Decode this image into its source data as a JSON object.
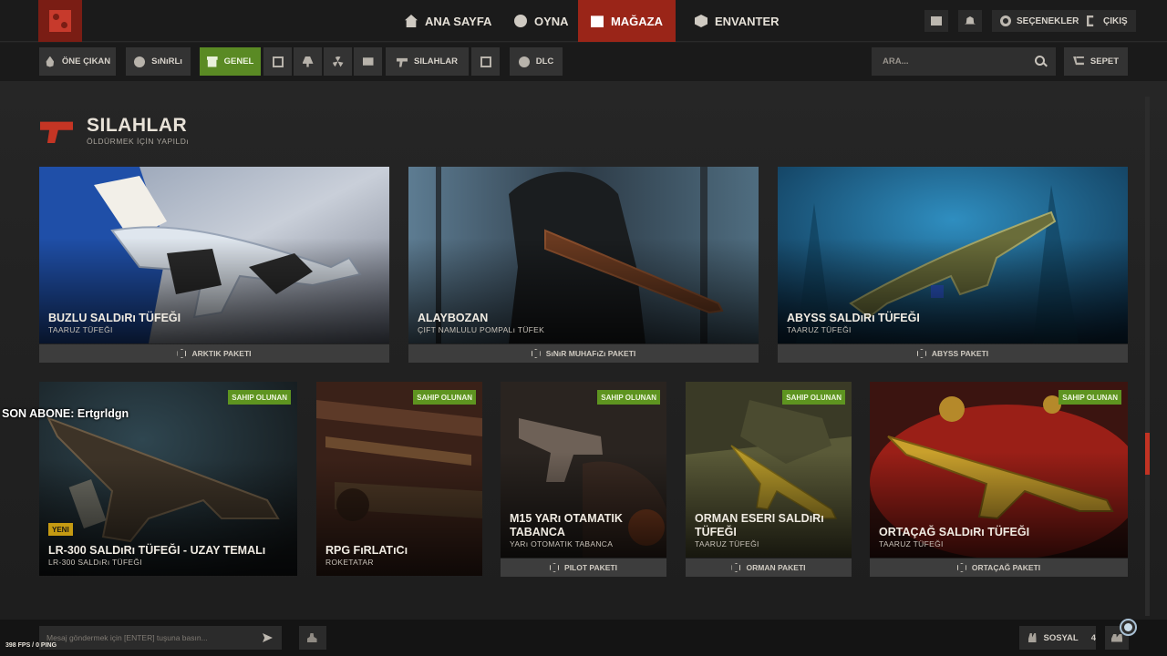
{
  "topnav": {
    "items": [
      {
        "label": "ANA SAYFA",
        "icon": "home-icon"
      },
      {
        "label": "OYNA",
        "icon": "play-icon"
      },
      {
        "label": "MAĞAZA",
        "icon": "store-icon",
        "active": true
      },
      {
        "label": "ENVANTER",
        "icon": "inventory-icon"
      }
    ],
    "options_label": "SEÇENEKLER",
    "exit_label": "ÇIKIŞ"
  },
  "subnav": {
    "featured_label": "ÖNE ÇIKAN",
    "limited_label": "SıNıRLı",
    "general_label": "GENEL",
    "weapons_label": "SILAHLAR",
    "dlc_label": "DLC",
    "search_placeholder": "ARA...",
    "cart_label": "SEPET"
  },
  "section": {
    "title": "SILAHLAR",
    "subtitle": "ÖLDÜRMEK İÇİN YAPILDı"
  },
  "large_cards": [
    {
      "title": "BUZLU SALDıRı TÜFEĞI",
      "subtitle": "TAARUZ TÜFEĞI",
      "package": "ARKTIK PAKETI"
    },
    {
      "title": "ALAYBOZAN",
      "subtitle": "ÇIFT NAMLULU POMPALı TÜFEK",
      "package": "SıNıR MUHAFıZı PAKETI"
    },
    {
      "title": "ABYSS SALDıRı TÜFEĞI",
      "subtitle": "TAARUZ TÜFEĞI",
      "package": "ABYSS PAKETI"
    }
  ],
  "small_cards": [
    {
      "title": "LR-300 SALDıRı TÜFEĞI - UZAY TEMALı",
      "subtitle": "LR-300 SALDıRı TÜFEĞI",
      "badge": "SAHIP OLUNAN",
      "tag": "YENI"
    },
    {
      "title": "RPG FıRLATıCı",
      "subtitle": "ROKETATAR",
      "badge": "SAHIP OLUNAN"
    },
    {
      "title_line1": "M15 YARı OTAMATIK",
      "title_line2": "TABANCA",
      "subtitle": "YARı OTOMATIK TABANCA",
      "badge": "SAHIP OLUNAN",
      "package": "PILOT PAKETI"
    },
    {
      "title_line1": "ORMAN ESERI SALDıRı",
      "title_line2": "TÜFEĞI",
      "subtitle": "TAARUZ TÜFEĞI",
      "badge": "SAHIP OLUNAN",
      "package": "ORMAN PAKETI"
    },
    {
      "title": "ORTAÇAĞ SALDıRı TÜFEĞI",
      "subtitle": "TAARUZ TÜFEĞI",
      "badge": "SAHIP OLUNAN",
      "package": "ORTAÇAĞ PAKETI"
    }
  ],
  "overlay": {
    "text": "SON ABONE: Ertgrldgn"
  },
  "bottom": {
    "chat_placeholder": "Mesaj göndermek için [ENTER] tuşuna basın...",
    "social_label": "SOSYAL",
    "social_count": "4",
    "fps_text": "398 FPS / 0 PING"
  },
  "colors": {
    "accent_red": "#9a2518",
    "accent_green": "#5a8a24",
    "new_tag": "#c59a12"
  }
}
